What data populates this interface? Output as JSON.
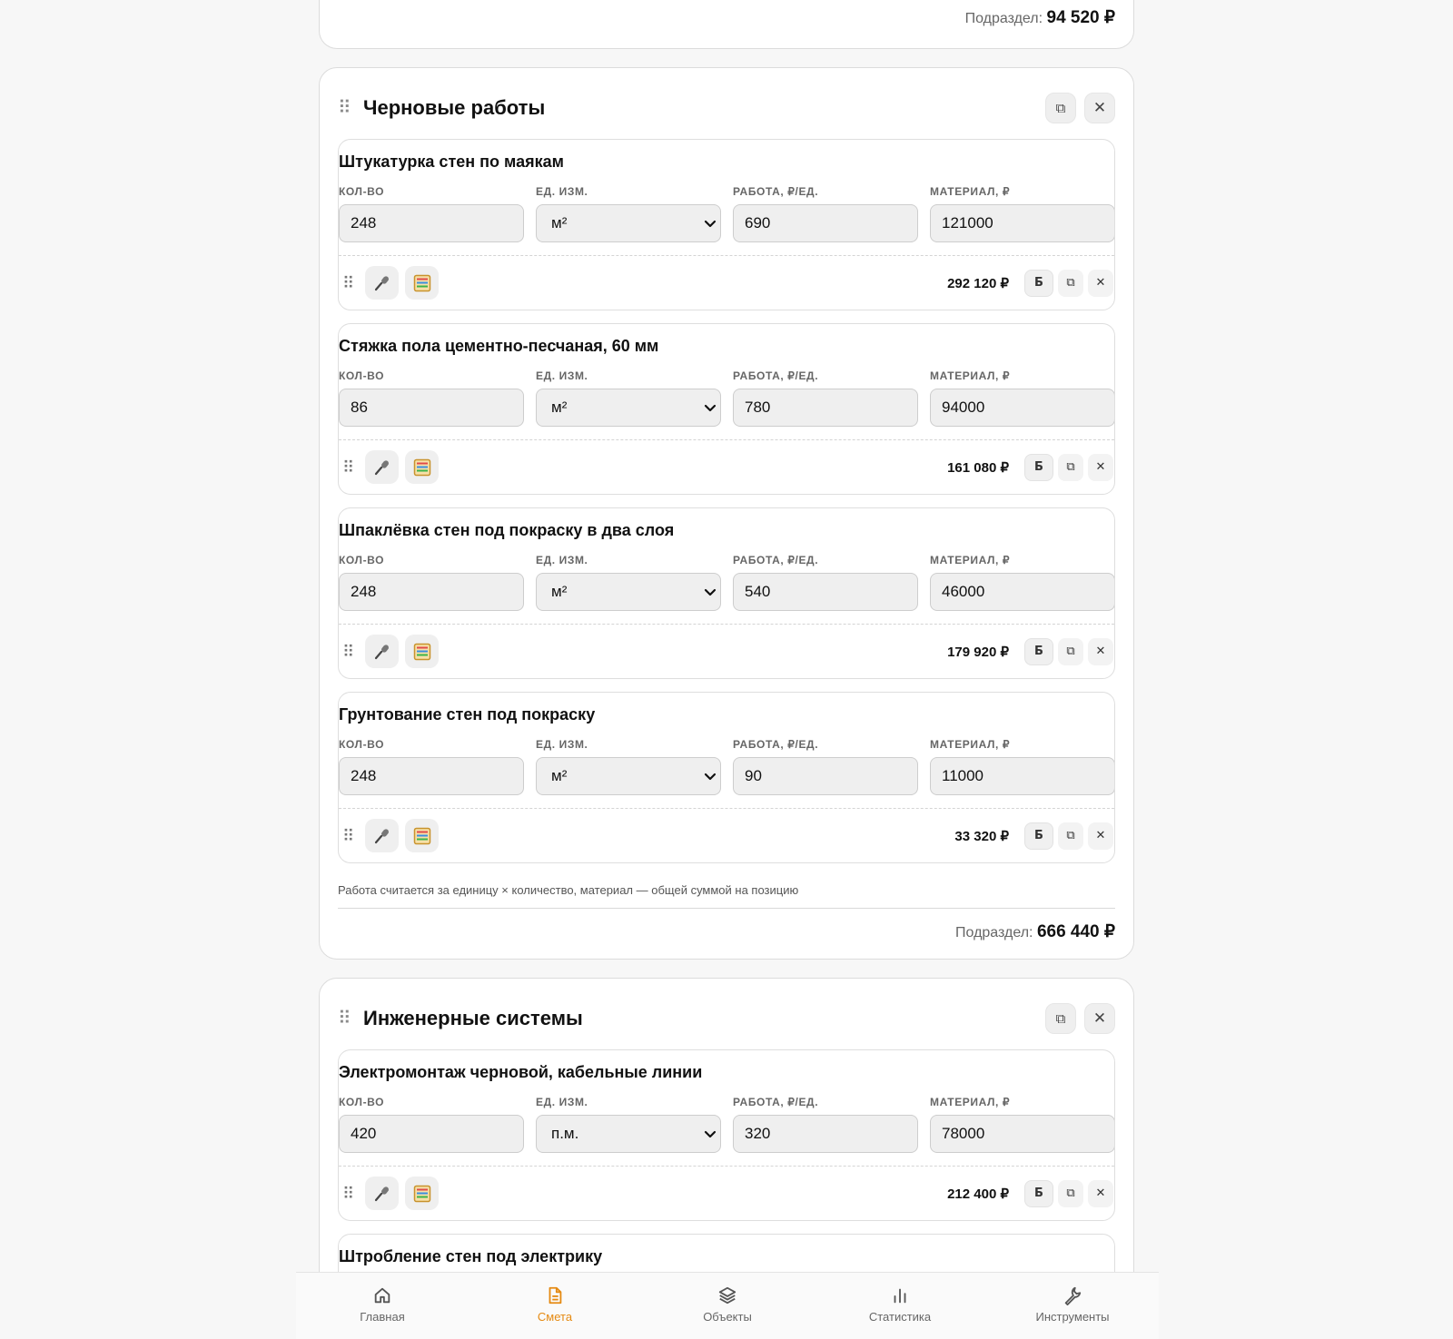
{
  "prev_section": {
    "subtotal_label": "Подраздел:",
    "subtotal_value": "94 520 ₽"
  },
  "sections": [
    {
      "title": "Черновые работы",
      "labels": {
        "qty": "КОЛ-ВО",
        "unit": "ЕД. ИЗМ.",
        "work": "РАБОТА, ₽/ЕД.",
        "material": "МАТЕРИАЛ, ₽"
      },
      "items": [
        {
          "title": "Штукатурка стен по маякам",
          "qty": "248",
          "unit": "м²",
          "work": "690",
          "material": "121000",
          "total": "292 120 ₽"
        },
        {
          "title": "Стяжка пола цементно-песчаная, 60 мм",
          "qty": "86",
          "unit": "м²",
          "work": "780",
          "material": "94000",
          "total": "161 080 ₽"
        },
        {
          "title": "Шпаклёвка стен под покраску в два слоя",
          "qty": "248",
          "unit": "м²",
          "work": "540",
          "material": "46000",
          "total": "179 920 ₽"
        },
        {
          "title": "Грунтование стен под покраску",
          "qty": "248",
          "unit": "м²",
          "work": "90",
          "material": "11000",
          "total": "33 320 ₽"
        }
      ],
      "hint": "Работа считается за единицу × количество, материал — общей суммой на позицию",
      "subtotal_label": "Подраздел:",
      "subtotal_value": "666 440 ₽"
    },
    {
      "title": "Инженерные системы",
      "items": [
        {
          "title": "Электромонтаж черновой, кабельные линии",
          "qty": "420",
          "unit": "п.м.",
          "work": "320",
          "material": "78000",
          "total": "212 400 ₽"
        },
        {
          "title": "Штробление стен под электрику"
        }
      ]
    }
  ],
  "item_actions": {
    "b_label": "Б",
    "copy_glyph": "⧉",
    "close_glyph": "✕"
  },
  "icons": {
    "drag": "drag-handle-icon",
    "mic": "microphone-icon",
    "calc": "abacus-icon",
    "copy": "copy-icon",
    "close": "close-icon"
  },
  "nav": [
    {
      "label": "Главная",
      "icon": "home-icon",
      "active": false
    },
    {
      "label": "Смета",
      "icon": "document-icon",
      "active": true
    },
    {
      "label": "Объекты",
      "icon": "layers-icon",
      "active": false
    },
    {
      "label": "Статистика",
      "icon": "bar-chart-icon",
      "active": false
    },
    {
      "label": "Инструменты",
      "icon": "wrench-icon",
      "active": false
    }
  ],
  "colors": {
    "accent": "#e58a12",
    "background": "#f7f7f7"
  }
}
